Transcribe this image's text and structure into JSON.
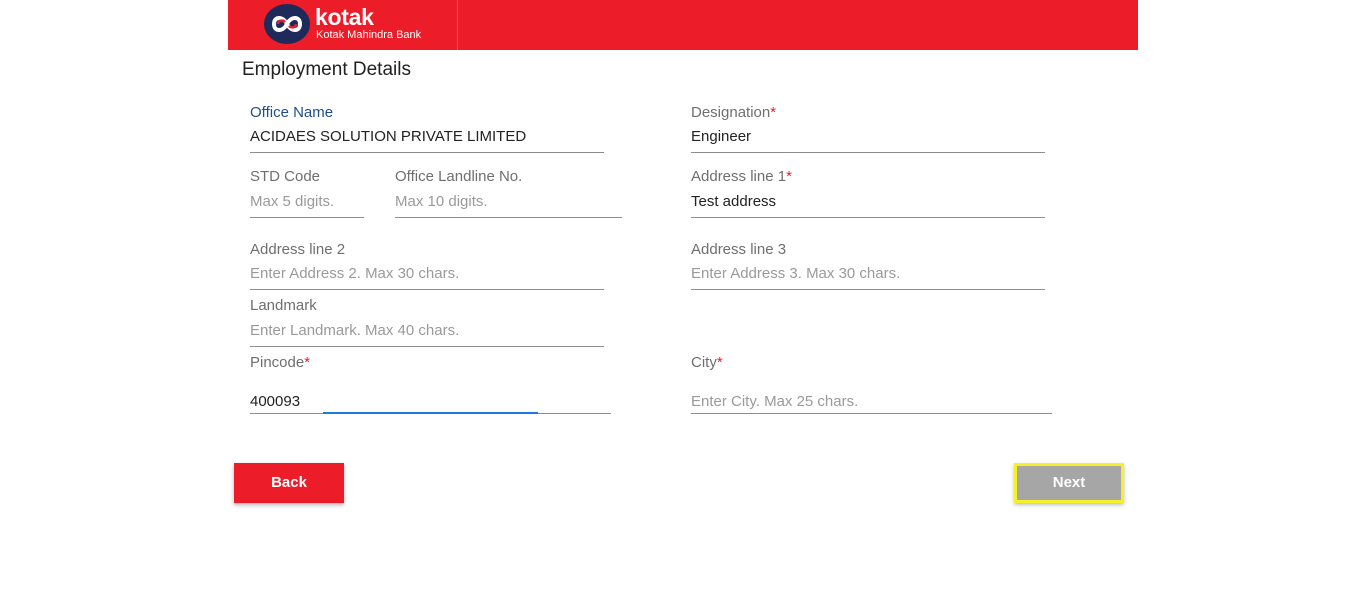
{
  "header": {
    "brand_name": "kotak",
    "brand_sub": "Kotak Mahindra Bank",
    "logo_icon": "kotak-infinity-logo",
    "colors": {
      "brand_red": "#ed1c29",
      "logo_navy": "#1e2a5a"
    }
  },
  "page": {
    "title": "Employment Details"
  },
  "fields": {
    "office_name": {
      "label": "Office Name",
      "value": "ACIDAES SOLUTION PRIVATE LIMITED"
    },
    "designation": {
      "label": "Designation",
      "required": "*",
      "value": "Engineer"
    },
    "std_code": {
      "label": "STD Code",
      "placeholder": "Max 5 digits."
    },
    "office_landline": {
      "label": "Office Landline No.",
      "placeholder": "Max 10 digits."
    },
    "address_line1": {
      "label": "Address line 1",
      "required": "*",
      "value": "Test address"
    },
    "address_line2": {
      "label": "Address line 2",
      "placeholder": "Enter Address 2. Max 30 chars."
    },
    "address_line3": {
      "label": "Address line 3",
      "placeholder": "Enter Address 3. Max 30 chars."
    },
    "landmark": {
      "label": "Landmark",
      "placeholder": "Enter Landmark. Max 40 chars."
    },
    "pincode": {
      "label": "Pincode",
      "required": "*",
      "value": "400093"
    },
    "city": {
      "label": "City",
      "required": "*",
      "placeholder": "Enter City. Max 25 chars."
    }
  },
  "buttons": {
    "back_label": "Back",
    "next_label": "Next"
  },
  "colors": {
    "focus_blue": "#1f7ad8",
    "required_red": "#e8202a",
    "next_highlight": "#f4f12a",
    "next_disabled": "#a6a6a6"
  }
}
